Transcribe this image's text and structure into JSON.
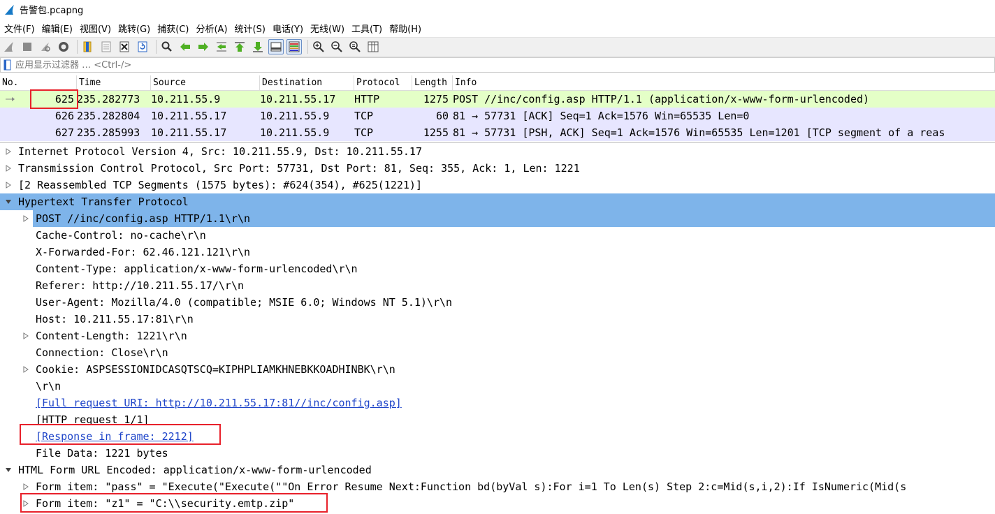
{
  "window": {
    "title": "告警包.pcapng"
  },
  "menu": [
    "文件(F)",
    "编辑(E)",
    "视图(V)",
    "跳转(G)",
    "捕获(C)",
    "分析(A)",
    "统计(S)",
    "电话(Y)",
    "无线(W)",
    "工具(T)",
    "帮助(H)"
  ],
  "toolbar": {
    "icons": [
      "shark-fin-start-icon",
      "stop-icon",
      "restart-icon",
      "capture-options-icon",
      "open-file-icon",
      "save-file-icon",
      "close-file-icon",
      "reload-icon",
      "find-packet-icon",
      "go-back-icon",
      "go-forward-icon",
      "go-to-packet-icon",
      "go-first-icon",
      "go-last-icon",
      "auto-scroll-icon",
      "colorize-icon",
      "zoom-in-icon",
      "zoom-out-icon",
      "zoom-normal-icon",
      "resize-columns-icon"
    ]
  },
  "filter": {
    "placeholder": "应用显示过滤器 … <Ctrl-/>"
  },
  "packet_list": {
    "columns": [
      "No.",
      "Time",
      "Source",
      "Destination",
      "Protocol",
      "Length",
      "Info"
    ],
    "rows": [
      {
        "no": "625",
        "time": "235.282773",
        "source": "10.211.55.9",
        "destination": "10.211.55.17",
        "protocol": "HTTP",
        "length": "1275",
        "info": "POST //inc/config.asp HTTP/1.1  (application/x-www-form-urlencoded)"
      },
      {
        "no": "626",
        "time": "235.282804",
        "source": "10.211.55.17",
        "destination": "10.211.55.9",
        "protocol": "TCP",
        "length": "60",
        "info": "81 → 57731 [ACK] Seq=1 Ack=1576 Win=65535 Len=0"
      },
      {
        "no": "627",
        "time": "235.285993",
        "source": "10.211.55.17",
        "destination": "10.211.55.9",
        "protocol": "TCP",
        "length": "1255",
        "info": "81 → 57731 [PSH, ACK] Seq=1 Ack=1576 Win=65535 Len=1201 [TCP segment of a reas"
      }
    ]
  },
  "details": [
    {
      "text": "Internet Protocol Version 4, Src: 10.211.55.9, Dst: 10.211.55.17",
      "arrow": "collapsed",
      "level": 0
    },
    {
      "text": "Transmission Control Protocol, Src Port: 57731, Dst Port: 81, Seq: 355, Ack: 1, Len: 1221",
      "arrow": "collapsed",
      "level": 0
    },
    {
      "text": "[2 Reassembled TCP Segments (1575 bytes): #624(354), #625(1221)]",
      "arrow": "collapsed",
      "level": 0
    },
    {
      "text": "Hypertext Transfer Protocol",
      "arrow": "expanded",
      "level": 0,
      "selected": true
    },
    {
      "text": "POST //inc/config.asp HTTP/1.1\\r\\n",
      "arrow": "collapsed",
      "level": 1,
      "selected": true
    },
    {
      "text": "Cache-Control: no-cache\\r\\n",
      "arrow": "none",
      "level": 1
    },
    {
      "text": "X-Forwarded-For: 62.46.121.121\\r\\n",
      "arrow": "none",
      "level": 1
    },
    {
      "text": "Content-Type: application/x-www-form-urlencoded\\r\\n",
      "arrow": "none",
      "level": 1
    },
    {
      "text": "Referer: http://10.211.55.17/\\r\\n",
      "arrow": "none",
      "level": 1
    },
    {
      "text": "User-Agent: Mozilla/4.0 (compatible; MSIE 6.0; Windows NT 5.1)\\r\\n",
      "arrow": "none",
      "level": 1
    },
    {
      "text": "Host: 10.211.55.17:81\\r\\n",
      "arrow": "none",
      "level": 1
    },
    {
      "text": "Content-Length: 1221\\r\\n",
      "arrow": "collapsed",
      "level": 1
    },
    {
      "text": "Connection: Close\\r\\n",
      "arrow": "none",
      "level": 1
    },
    {
      "text": "Cookie: ASPSESSIONIDCASQTSCQ=KIPHPLIAMKHNEBKKOADHINBK\\r\\n",
      "arrow": "collapsed",
      "level": 1
    },
    {
      "text": "\\r\\n",
      "arrow": "none",
      "level": 1
    },
    {
      "text": "[Full request URI: http://10.211.55.17:81//inc/config.asp]",
      "arrow": "none",
      "level": 1,
      "link": true
    },
    {
      "text": "[HTTP request 1/1]",
      "arrow": "none",
      "level": 1
    },
    {
      "text": "[Response in frame: 2212]",
      "arrow": "none",
      "level": 1,
      "link": true
    },
    {
      "text": "File Data: 1221 bytes",
      "arrow": "none",
      "level": 1
    },
    {
      "text": "HTML Form URL Encoded: application/x-www-form-urlencoded",
      "arrow": "expanded",
      "level": 0
    },
    {
      "text": "Form item: \"pass\" = \"Execute(\"Execute(\"\"On Error Resume Next:Function bd(byVal s):For i=1 To Len(s) Step 2:c=Mid(s,i,2):If IsNumeric(Mid(s",
      "arrow": "collapsed",
      "level": 1
    },
    {
      "text": "Form item: \"z1\" = \"C:\\\\security.emtp.zip\"",
      "arrow": "collapsed",
      "level": 1
    }
  ],
  "colors": {
    "selection": "#7eb4ea",
    "http_row": "#e4ffc7",
    "tcp_row": "#e7e6ff",
    "link": "#1f45c9",
    "highlight_box": "#e8212b"
  }
}
